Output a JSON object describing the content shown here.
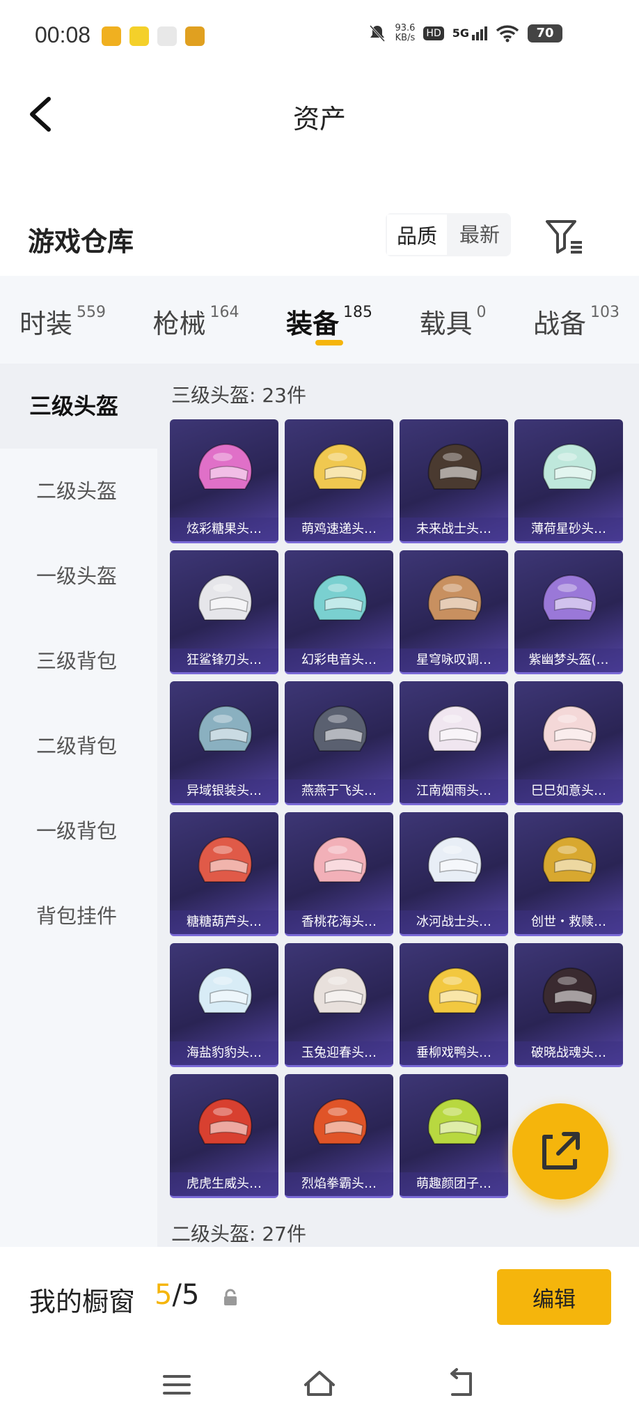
{
  "status_bar": {
    "time": "00:08",
    "net_speed_value": "93.6",
    "net_speed_unit": "KB/s",
    "hd_label": "HD",
    "network_label": "5G",
    "battery": "70",
    "app_icons": [
      "#f0b020",
      "#f4d02a",
      "#e8e8e8",
      "#e0a020"
    ]
  },
  "header": {
    "title": "资产",
    "back_icon": "chevron-left-icon"
  },
  "warehouse": {
    "title": "游戏仓库",
    "sort_options": [
      {
        "label": "品质",
        "active": true
      },
      {
        "label": "最新",
        "active": false
      }
    ],
    "filter_icon": "filter-icon"
  },
  "tabs": [
    {
      "label": "时装",
      "count": "559"
    },
    {
      "label": "枪械",
      "count": "164"
    },
    {
      "label": "装备",
      "count": "185",
      "active": true
    },
    {
      "label": "载具",
      "count": "0"
    },
    {
      "label": "战备",
      "count": "103"
    }
  ],
  "sidebar": [
    {
      "label": "三级头盔",
      "active": true
    },
    {
      "label": "二级头盔"
    },
    {
      "label": "一级头盔"
    },
    {
      "label": "三级背包"
    },
    {
      "label": "二级背包"
    },
    {
      "label": "一级背包"
    },
    {
      "label": "背包挂件"
    }
  ],
  "section": {
    "title": "三级头盔: 23件",
    "next_title": "二级头盔: 27件",
    "items": [
      {
        "name": "炫彩糖果头…",
        "color": "#e070c8"
      },
      {
        "name": "萌鸡速递头…",
        "color": "#f0c850"
      },
      {
        "name": "未来战士头…",
        "color": "#4a3a30"
      },
      {
        "name": "薄荷星砂头…",
        "color": "#bfe8dc"
      },
      {
        "name": "狂鲨锋刃头…",
        "color": "#e6e6ea"
      },
      {
        "name": "幻彩电音头…",
        "color": "#7ad0d0"
      },
      {
        "name": "星穹咏叹调…",
        "color": "#c89060"
      },
      {
        "name": "紫幽梦头盔(…",
        "color": "#9a78d8"
      },
      {
        "name": "异域银装头…",
        "color": "#8ab0c0"
      },
      {
        "name": "燕燕于飞头…",
        "color": "#5a6070"
      },
      {
        "name": "江南烟雨头…",
        "color": "#f0e6f0"
      },
      {
        "name": "巳巳如意头…",
        "color": "#f4d8d8"
      },
      {
        "name": "糖糖葫芦头…",
        "color": "#e05a48"
      },
      {
        "name": "香桃花海头…",
        "color": "#f2b0b8"
      },
      {
        "name": "冰河战士头…",
        "color": "#e8eef6"
      },
      {
        "name": "创世・救赎…",
        "color": "#d8a830"
      },
      {
        "name": "海盐豹豹头…",
        "color": "#d8ecf6"
      },
      {
        "name": "玉兔迎春头…",
        "color": "#e8e0dc"
      },
      {
        "name": "垂柳戏鸭头…",
        "color": "#f2c840"
      },
      {
        "name": "破晓战魂头…",
        "color": "#3a2a30"
      },
      {
        "name": "虎虎生威头…",
        "color": "#d84030"
      },
      {
        "name": "烈焰拳霸头…",
        "color": "#e05428"
      },
      {
        "name": "萌趣颜团子…",
        "color": "#b8d840"
      }
    ]
  },
  "fab": {
    "icon": "share-external-icon",
    "color": "#f5b50c"
  },
  "showcase": {
    "label": "我的橱窗",
    "current": "5",
    "separator": "/",
    "total": "5",
    "lock_icon": "lock-icon",
    "edit_label": "编辑"
  },
  "system_nav": {
    "icons": [
      "menu-icon",
      "home-icon",
      "back-icon"
    ]
  },
  "colors": {
    "accent": "#f5b50c",
    "card_bg": "#2a2454"
  }
}
